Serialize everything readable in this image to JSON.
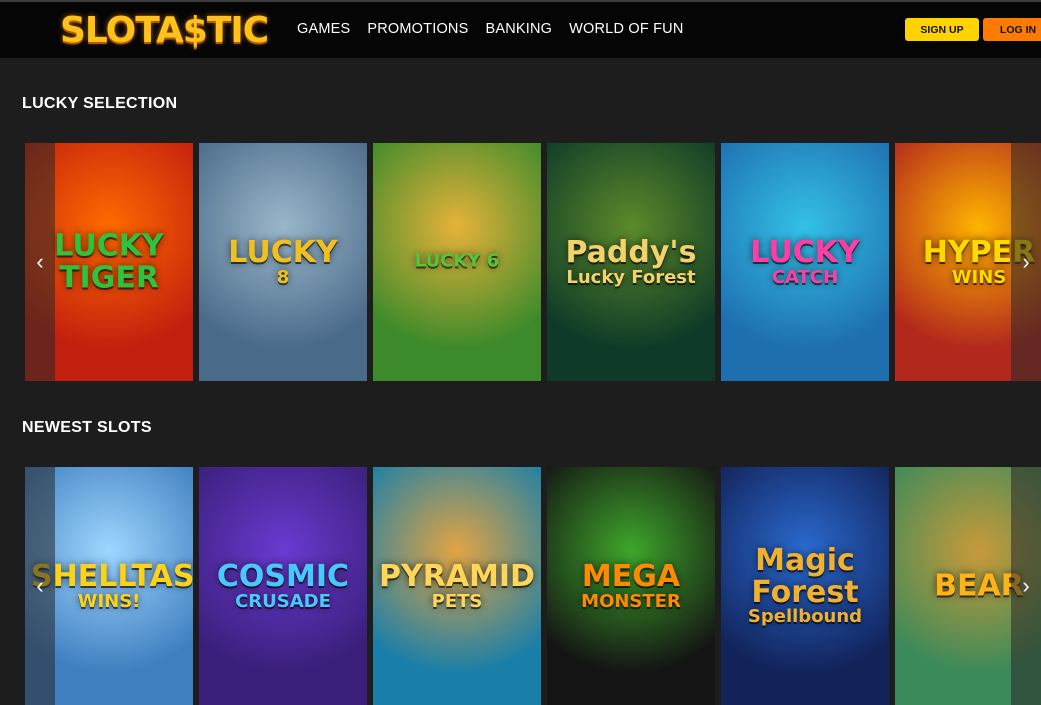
{
  "header": {
    "logo": "SLOTA$TIC",
    "nav": [
      "GAMES",
      "PROMOTIONS",
      "BANKING",
      "WORLD OF FUN"
    ],
    "signup_label": "SIGN UP",
    "login_label": "LOG IN"
  },
  "sections": [
    {
      "title": "LUCKY SELECTION",
      "games": [
        {
          "title": "LUCKY TIGER",
          "sub": "",
          "bg": "#c2200e",
          "accent": "#ff6a00",
          "text": "#2fc23a"
        },
        {
          "title": "LUCKY",
          "sub": "8",
          "bg": "#4a6a8a",
          "accent": "#9ab7c9",
          "text": "#f0c020"
        },
        {
          "title": "",
          "sub": "LUCKY 6",
          "bg": "#3c8a2a",
          "accent": "#e6b23a",
          "text": "#57c43c"
        },
        {
          "title": "Paddy's",
          "sub": "Lucky Forest",
          "bg": "#0f3a28",
          "accent": "#5b8a2a",
          "text": "#f2d26b"
        },
        {
          "title": "LUCKY",
          "sub": "CATCH",
          "bg": "#1e6fb0",
          "accent": "#34c1e6",
          "text": "#ff3ea5"
        },
        {
          "title": "HYPER",
          "sub": "WINS",
          "bg": "#b2281c",
          "accent": "#ffb400",
          "text": "#ffd800"
        }
      ]
    },
    {
      "title": "NEWEST SLOTS",
      "games": [
        {
          "title": "SHELLTASTIC",
          "sub": "WINS!",
          "bg": "#3f7fc0",
          "accent": "#9fd6ff",
          "text": "#ffd21a"
        },
        {
          "title": "COSMIC",
          "sub": "CRUSADE",
          "bg": "#3a1f7a",
          "accent": "#6a3ad0",
          "text": "#4ac7ff"
        },
        {
          "title": "PYRAMID",
          "sub": "PETS",
          "bg": "#1a7fa8",
          "accent": "#e2a443",
          "text": "#ffd65a"
        },
        {
          "title": "MEGA",
          "sub": "MONSTER",
          "bg": "#141414",
          "accent": "#3ea62a",
          "text": "#ff8a00"
        },
        {
          "title": "Magic Forest",
          "sub": "Spellbound",
          "bg": "#12235a",
          "accent": "#2a6ad0",
          "text": "#f0b030"
        },
        {
          "title": "BEAR",
          "sub": "",
          "bg": "#3a8a5a",
          "accent": "#c89a3a",
          "text": "#ffb21a"
        }
      ]
    }
  ],
  "arrows": {
    "left": "‹",
    "right": "›"
  }
}
